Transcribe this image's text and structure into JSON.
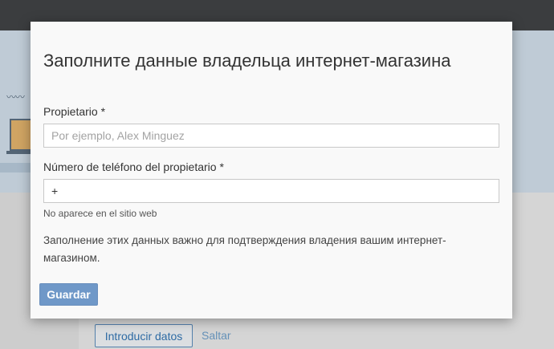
{
  "background": {
    "primary_button": "Introducir datos",
    "skip_link": "Saltar"
  },
  "modal": {
    "title": "Заполните данные владельца интернет-магазина",
    "owner": {
      "label": "Propietario *",
      "placeholder": "Por ejemplo, Alex Minguez",
      "value": ""
    },
    "phone": {
      "label": "Número de teléfono del propietario *",
      "value": "+",
      "hint": "No aparece en el sitio web"
    },
    "note": "Заполнение этих данных важно для подтверждения владения вашим интернет-магазином.",
    "save_label": "Guardar"
  },
  "colors": {
    "topbar": "#3e4043",
    "accent": "#6f98c8",
    "link": "#2f74b5"
  }
}
